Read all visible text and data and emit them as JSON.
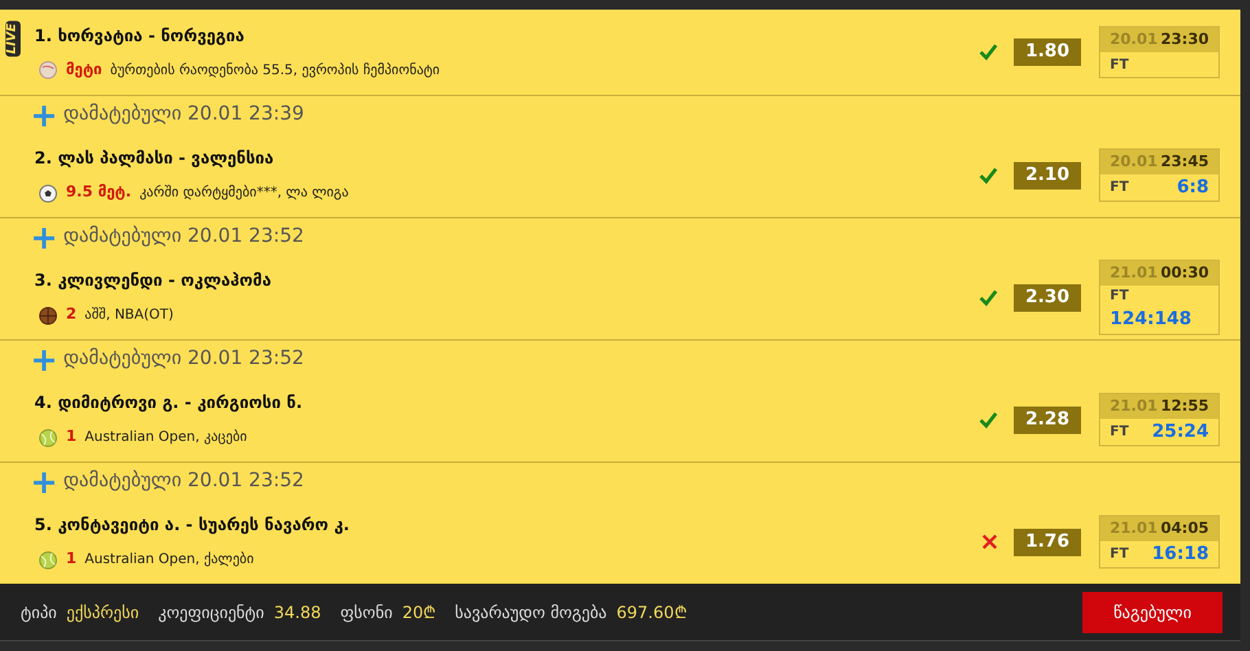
{
  "bets": [
    {
      "live": true,
      "live_label": "LIVE",
      "title": "1. ხორვატია - ნორვეგია",
      "kind": "handball",
      "pick": "მეტი",
      "market": "ბურთების რაოდენობა 55.5, ევროპის ჩემპიონატი",
      "won": true,
      "odds": "1.80",
      "date": "20.01",
      "time": "23:30",
      "status": "FT"
    },
    {
      "live": false,
      "added": {
        "plus": "+",
        "text": "დამატებული 20.01 23:39"
      },
      "title": "2. ლას პალმასი - ვალენსია",
      "kind": "football",
      "pick": "9.5 მეტ.",
      "market": "კარში დარტყმები***, ლა ლიგა",
      "won": true,
      "odds": "2.10",
      "date": "20.01",
      "time": "23:45",
      "status": "FT",
      "score": "6:8"
    },
    {
      "live": false,
      "added": {
        "plus": "+",
        "text": "დამატებული 20.01 23:52"
      },
      "title": "3. კლივლენდი - ოკლაჰომა",
      "kind": "basketball",
      "pick": "2",
      "market": "აშშ, NBA(OT)",
      "won": true,
      "odds": "2.30",
      "date": "21.01",
      "time": "00:30",
      "status": "FT",
      "score": "124:148"
    },
    {
      "live": false,
      "added": {
        "plus": "+",
        "text": "დამატებული 20.01 23:52"
      },
      "title": "4. დიმიტროვი გ. - კირგიოსი ნ.",
      "kind": "tennis",
      "pick": "1",
      "market": "Australian Open, კაცები",
      "won": true,
      "odds": "2.28",
      "date": "21.01",
      "time": "12:55",
      "status": "FT",
      "score": "25:24"
    },
    {
      "live": false,
      "added": {
        "plus": "+",
        "text": "დამატებული 20.01 23:52"
      },
      "title": "5. კონტავეიტი ა. - სუარეს ნავარო კ.",
      "kind": "tennis",
      "pick": "1",
      "market": "Australian Open, ქალები",
      "won": false,
      "odds": "1.76",
      "date": "21.01",
      "time": "04:05",
      "status": "FT",
      "score": "16:18"
    }
  ],
  "footer": {
    "items": [
      {
        "label": "ტიპი",
        "value": "ექსპრესი"
      },
      {
        "label": "კოეფიციენტი",
        "value": "34.88"
      },
      {
        "label": "ფსონი",
        "value": "20₾"
      },
      {
        "label": "სავარაუდო მოგება",
        "value": "697.60₾"
      }
    ],
    "status_button": "წაგებული"
  }
}
